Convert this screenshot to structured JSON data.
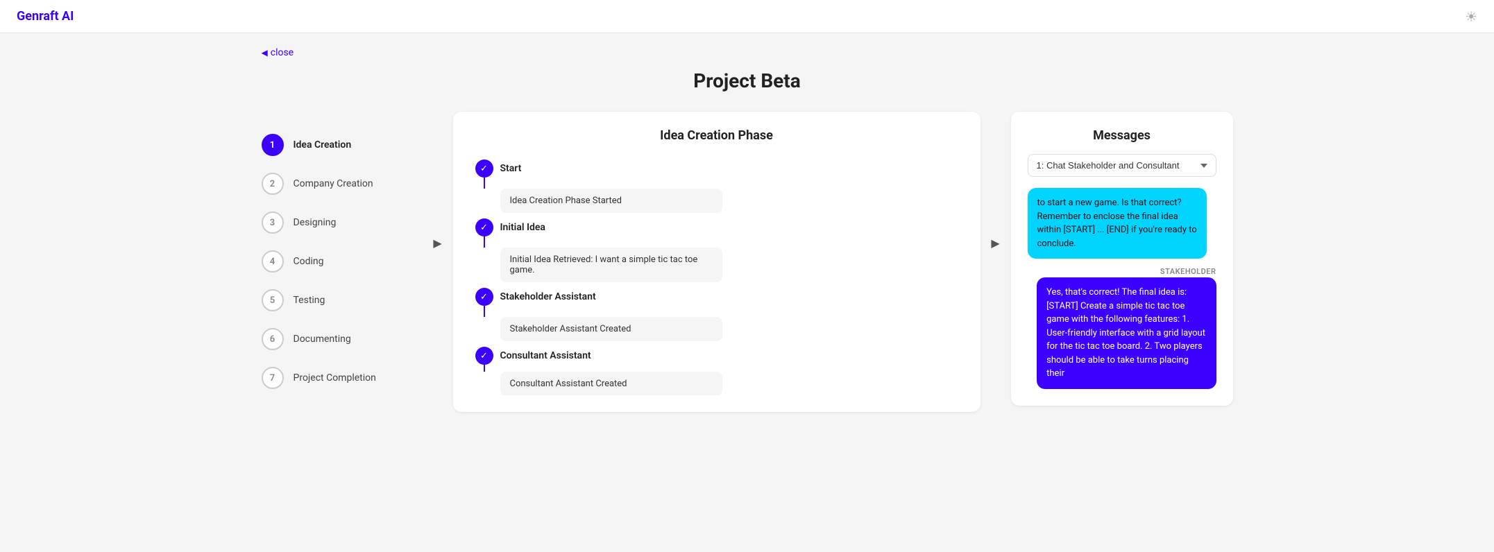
{
  "header": {
    "logo": "Genraft AI",
    "theme_icon": "☀"
  },
  "close_link": "close",
  "page_title": "Project Beta",
  "sidebar": {
    "steps": [
      {
        "number": "1",
        "label": "Idea Creation",
        "active": true
      },
      {
        "number": "2",
        "label": "Company Creation",
        "active": false
      },
      {
        "number": "3",
        "label": "Designing",
        "active": false
      },
      {
        "number": "4",
        "label": "Coding",
        "active": false
      },
      {
        "number": "5",
        "label": "Testing",
        "active": false
      },
      {
        "number": "6",
        "label": "Documenting",
        "active": false
      },
      {
        "number": "7",
        "label": "Project Completion",
        "active": false
      }
    ]
  },
  "center_panel": {
    "title": "Idea Creation Phase",
    "timeline": [
      {
        "label": "Start",
        "card": "Idea Creation Phase Started"
      },
      {
        "label": "Initial Idea",
        "card": "Initial Idea Retrieved: I want a simple tic tac toe game."
      },
      {
        "label": "Stakeholder Assistant",
        "card": "Stakeholder Assistant Created"
      },
      {
        "label": "Consultant Assistant",
        "card": "Consultant Assistant Created"
      }
    ]
  },
  "messages_panel": {
    "title": "Messages",
    "dropdown_option": "1: Chat Stakeholder and Consultant",
    "messages": [
      {
        "type": "left",
        "color": "cyan",
        "text": "to start a new game. Is that correct? Remember to enclose the final idea within [START] ... [END] if you're ready to conclude.",
        "sender": ""
      },
      {
        "type": "right",
        "color": "blue",
        "sender": "STAKEHOLDER",
        "text": "Yes, that's correct! The final idea is: [START] Create a simple tic tac toe game with the following features: 1. User-friendly interface with a grid layout for the tic tac toe board. 2. Two players should be able to take turns placing their"
      }
    ]
  }
}
